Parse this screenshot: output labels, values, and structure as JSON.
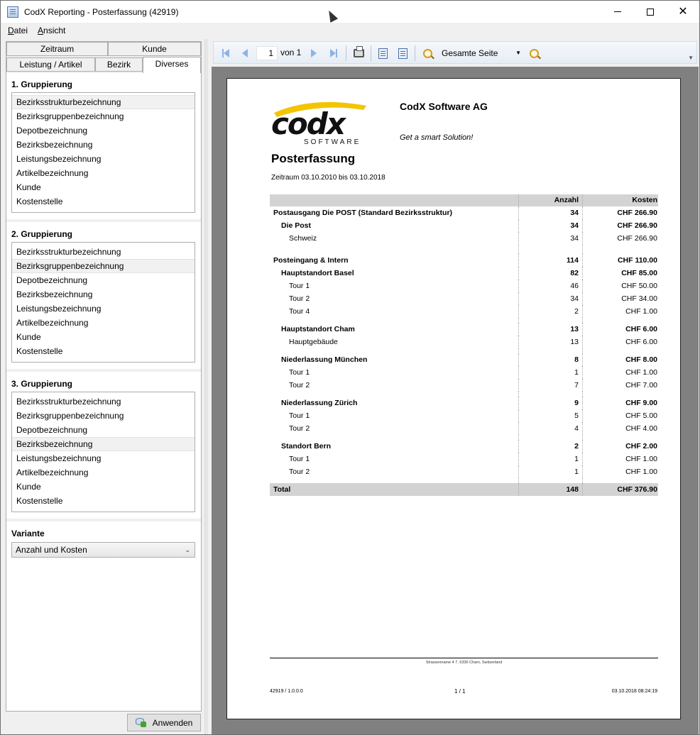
{
  "window": {
    "title": "CodX Reporting - Posterfassung (42919)"
  },
  "menu": [
    "Datei",
    "Ansicht"
  ],
  "tabs": {
    "row1": [
      "Zeitraum",
      "Kunde"
    ],
    "row2": [
      "Leistung / Artikel",
      "Bezirk",
      "Diverses"
    ]
  },
  "groups": [
    {
      "title": "1. Gruppierung",
      "selected": 0,
      "items": [
        "Bezirksstrukturbezeichnung",
        "Bezirksgruppenbezeichnung",
        "Depotbezeichnung",
        "Bezirksbezeichnung",
        "Leistungsbezeichnung",
        "Artikelbezeichnung",
        "Kunde",
        "Kostenstelle"
      ]
    },
    {
      "title": "2. Gruppierung",
      "selected": 1,
      "items": [
        "Bezirksstrukturbezeichnung",
        "Bezirksgruppenbezeichnung",
        "Depotbezeichnung",
        "Bezirksbezeichnung",
        "Leistungsbezeichnung",
        "Artikelbezeichnung",
        "Kunde",
        "Kostenstelle"
      ]
    },
    {
      "title": "3. Gruppierung",
      "selected": 3,
      "items": [
        "Bezirksstrukturbezeichnung",
        "Bezirksgruppenbezeichnung",
        "Depotbezeichnung",
        "Bezirksbezeichnung",
        "Leistungsbezeichnung",
        "Artikelbezeichnung",
        "Kunde",
        "Kostenstelle"
      ]
    }
  ],
  "variant": {
    "title": "Variante",
    "value": "Anzahl und Kosten"
  },
  "apply_label": "Anwenden",
  "toolbar": {
    "page": "1",
    "of_label": "von 1",
    "zoom": "Gesamte Seite"
  },
  "report": {
    "logo_text": "codx",
    "logo_sub": "SOFTWARE",
    "company": "CodX Software AG",
    "slogan": "Get a smart Solution!",
    "title": "Posterfassung",
    "period": "Zeitraum 03.10.2010 bis 03.10.2018",
    "columns": [
      "",
      "Anzahl",
      "Kosten"
    ],
    "rows": [
      {
        "label": "Postausgang Die POST (Standard Bezirksstruktur)",
        "count": "34",
        "cost": "CHF 266.90",
        "level": 1,
        "bold": true
      },
      {
        "label": "Die Post",
        "count": "34",
        "cost": "CHF 266.90",
        "level": 2,
        "bold": true
      },
      {
        "label": "Schweiz",
        "count": "34",
        "cost": "CHF 266.90",
        "level": 3,
        "bold": false
      },
      {
        "gap": true
      },
      {
        "label": "Posteingang & Intern",
        "count": "114",
        "cost": "CHF 110.00",
        "level": 1,
        "bold": true
      },
      {
        "label": "Hauptstandort Basel",
        "count": "82",
        "cost": "CHF 85.00",
        "level": 2,
        "bold": true
      },
      {
        "label": "Tour 1",
        "count": "46",
        "cost": "CHF 50.00",
        "level": 3,
        "bold": false
      },
      {
        "label": "Tour 2",
        "count": "34",
        "cost": "CHF 34.00",
        "level": 3,
        "bold": false
      },
      {
        "label": "Tour 4",
        "count": "2",
        "cost": "CHF 1.00",
        "level": 3,
        "bold": false
      },
      {
        "gapsmall": true
      },
      {
        "label": "Hauptstandort Cham",
        "count": "13",
        "cost": "CHF 6.00",
        "level": 2,
        "bold": true
      },
      {
        "label": "Hauptgebäude",
        "count": "13",
        "cost": "CHF 6.00",
        "level": 3,
        "bold": false
      },
      {
        "gapsmall": true
      },
      {
        "label": "Niederlassung München",
        "count": "8",
        "cost": "CHF 8.00",
        "level": 2,
        "bold": true
      },
      {
        "label": "Tour 1",
        "count": "1",
        "cost": "CHF 1.00",
        "level": 3,
        "bold": false
      },
      {
        "label": "Tour 2",
        "count": "7",
        "cost": "CHF 7.00",
        "level": 3,
        "bold": false
      },
      {
        "gapsmall": true
      },
      {
        "label": "Niederlassung Zürich",
        "count": "9",
        "cost": "CHF 9.00",
        "level": 2,
        "bold": true
      },
      {
        "label": "Tour 1",
        "count": "5",
        "cost": "CHF 5.00",
        "level": 3,
        "bold": false
      },
      {
        "label": "Tour 2",
        "count": "4",
        "cost": "CHF 4.00",
        "level": 3,
        "bold": false
      },
      {
        "gapsmall": true
      },
      {
        "label": "Standort Bern",
        "count": "2",
        "cost": "CHF 2.00",
        "level": 2,
        "bold": true
      },
      {
        "label": "Tour 1",
        "count": "1",
        "cost": "CHF 1.00",
        "level": 3,
        "bold": false
      },
      {
        "label": "Tour 2",
        "count": "1",
        "cost": "CHF 1.00",
        "level": 3,
        "bold": false
      },
      {
        "gapsmall": true
      }
    ],
    "total": {
      "label": "Total",
      "count": "148",
      "cost": "CHF 376.90"
    },
    "footer_address": "Strassenname 4 7, 6330 Cham, Switzerland",
    "footer_left": "42919 / 1.0.0.0",
    "footer_page": "1 / 1",
    "footer_right": "03.10.2018 08:24:19"
  }
}
